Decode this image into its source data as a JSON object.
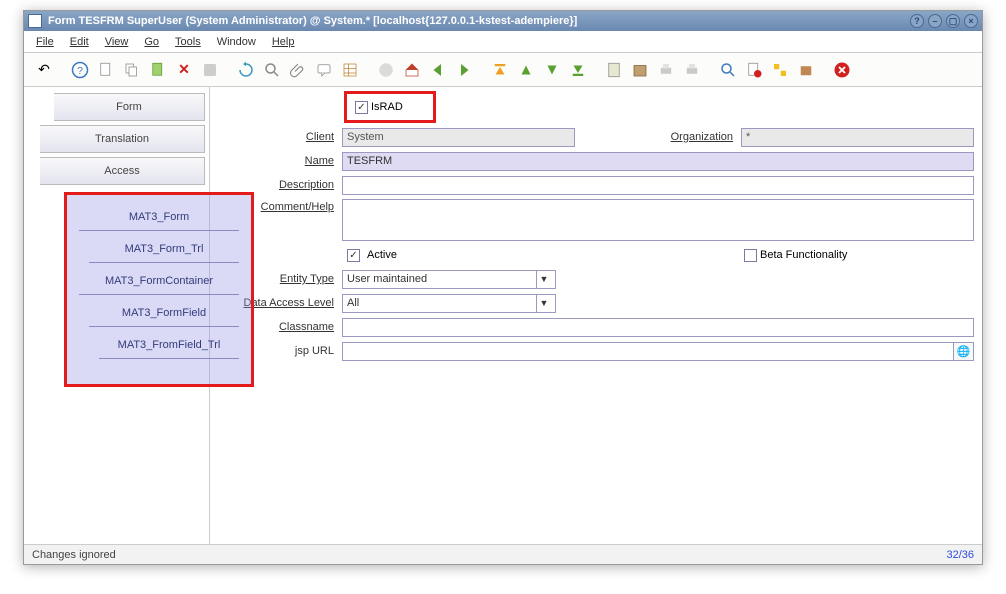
{
  "window": {
    "title": "Form  TESFRM  SuperUser (System Administrator) @ System.* [localhost{127.0.0.1-kstest-adempiere}]"
  },
  "menu": {
    "file": "File",
    "edit": "Edit",
    "view": "View",
    "go": "Go",
    "tools": "Tools",
    "window": "Window",
    "help": "Help"
  },
  "sidebar": {
    "tabs": [
      "Form",
      "Translation",
      "Access"
    ],
    "subtabs": [
      "MAT3_Form",
      "MAT3_Form_Trl",
      "MAT3_FormContainer",
      "MAT3_FormField",
      "MAT3_FromField_Trl"
    ]
  },
  "form": {
    "israd_label": "IsRAD",
    "client_label": "Client",
    "client_value": "System",
    "organization_label": "Organization",
    "organization_value": "*",
    "name_label": "Name",
    "name_value": "TESFRM",
    "description_label": "Description",
    "description_value": "",
    "comment_label": "Comment/Help",
    "comment_value": "",
    "active_label": "Active",
    "beta_label": "Beta Functionality",
    "entity_type_label": "Entity Type",
    "entity_type_value": "User maintained",
    "data_access_label": "Data Access Level",
    "data_access_value": "All",
    "classname_label": "Classname",
    "classname_value": "",
    "jsp_url_label": "jsp URL",
    "jsp_url_value": ""
  },
  "status": {
    "message": "Changes ignored",
    "counter": "32/36"
  }
}
